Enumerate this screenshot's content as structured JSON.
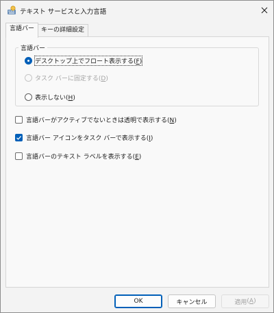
{
  "window": {
    "title": "テキスト サービスと入力言語",
    "icon": "keyboard-globe-icon"
  },
  "tabs": [
    {
      "label": "言語バー",
      "active": true
    },
    {
      "label": "キーの詳細設定",
      "active": false
    }
  ],
  "group": {
    "label": "言語バー",
    "options": [
      {
        "label": "デスクトップ上でフロート表示する",
        "accel": "F",
        "checked": true,
        "enabled": true
      },
      {
        "label": "タスク バーに固定する",
        "accel": "D",
        "checked": false,
        "enabled": false
      },
      {
        "label": "表示しない",
        "accel": "H",
        "checked": false,
        "enabled": true
      }
    ]
  },
  "checkboxes": [
    {
      "label": "言語バーがアクティブでないときは透明で表示する",
      "accel": "N",
      "checked": false
    },
    {
      "label": "言語バー アイコンをタスク バーで表示する",
      "accel": "I",
      "checked": true
    },
    {
      "label": "言語バーのテキスト ラベルを表示する",
      "accel": "E",
      "checked": false
    }
  ],
  "buttons": {
    "ok": "OK",
    "cancel": "キャンセル",
    "apply": "適用",
    "apply_accel": "A"
  },
  "colors": {
    "accent": "#005fb8",
    "background": "#f3f3f3",
    "panel": "#f9f9f9"
  }
}
